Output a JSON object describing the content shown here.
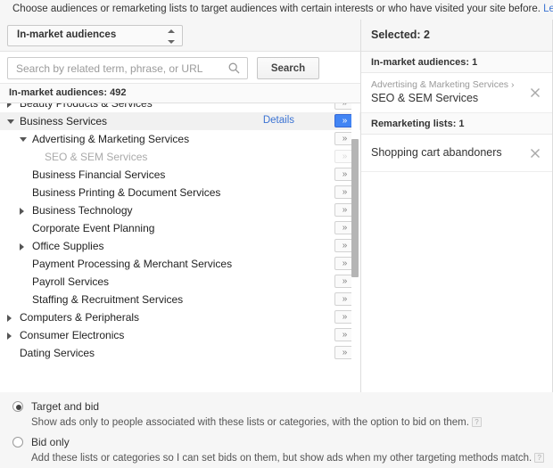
{
  "header": {
    "intro_text": "Choose audiences or remarketing lists to target audiences with certain interests or who have visited your site before.",
    "learn_more": "Learn more"
  },
  "picker": {
    "dropdown_value": "In-market audiences",
    "search": {
      "placeholder": "Search by related term, phrase, or URL",
      "value": "",
      "button_label": "Search",
      "icon": "search-icon"
    },
    "list_count_label": "In-market audiences: 492",
    "chevron_glyph": "»",
    "details_label": "Details",
    "rows": [
      {
        "label": "Beauty Products & Services",
        "indent": 0,
        "arrow": "right",
        "state": "normal",
        "chev": "normal",
        "details": false
      },
      {
        "label": "Business Services",
        "indent": 0,
        "arrow": "down",
        "state": "selected",
        "chev": "blue",
        "details": true
      },
      {
        "label": "Advertising & Marketing Services",
        "indent": 1,
        "arrow": "down",
        "state": "normal",
        "chev": "normal",
        "details": false
      },
      {
        "label": "SEO & SEM Services",
        "indent": 2,
        "arrow": "none",
        "state": "disabled",
        "chev": "off",
        "details": false
      },
      {
        "label": "Business Financial Services",
        "indent": 1,
        "arrow": "none",
        "state": "normal",
        "chev": "normal",
        "details": false
      },
      {
        "label": "Business Printing & Document Services",
        "indent": 1,
        "arrow": "none",
        "state": "normal",
        "chev": "normal",
        "details": false
      },
      {
        "label": "Business Technology",
        "indent": 1,
        "arrow": "right",
        "state": "normal",
        "chev": "normal",
        "details": false
      },
      {
        "label": "Corporate Event Planning",
        "indent": 1,
        "arrow": "none",
        "state": "normal",
        "chev": "normal",
        "details": false
      },
      {
        "label": "Office Supplies",
        "indent": 1,
        "arrow": "right",
        "state": "normal",
        "chev": "normal",
        "details": false
      },
      {
        "label": "Payment Processing & Merchant Services",
        "indent": 1,
        "arrow": "none",
        "state": "normal",
        "chev": "normal",
        "details": false
      },
      {
        "label": "Payroll Services",
        "indent": 1,
        "arrow": "none",
        "state": "normal",
        "chev": "normal",
        "details": false
      },
      {
        "label": "Staffing & Recruitment Services",
        "indent": 1,
        "arrow": "none",
        "state": "normal",
        "chev": "normal",
        "details": false
      },
      {
        "label": "Computers & Peripherals",
        "indent": 0,
        "arrow": "right",
        "state": "normal",
        "chev": "normal",
        "details": false
      },
      {
        "label": "Consumer Electronics",
        "indent": 0,
        "arrow": "right",
        "state": "normal",
        "chev": "normal",
        "details": false
      },
      {
        "label": "Dating Services",
        "indent": 0,
        "arrow": "none",
        "state": "normal",
        "chev": "normal",
        "details": false
      }
    ]
  },
  "selected": {
    "title": "Selected: 2",
    "groups": [
      {
        "title": "In-market audiences: 1",
        "items": [
          {
            "path": "Advertising & Marketing Services ›",
            "name": "SEO & SEM Services"
          }
        ]
      },
      {
        "title": "Remarketing lists: 1",
        "items": [
          {
            "path": "",
            "name": "Shopping cart abandoners"
          }
        ]
      }
    ]
  },
  "targeting": {
    "options": [
      {
        "title": "Target and bid",
        "description": "Show ads only to people associated with these lists or categories, with the option to bid on them.",
        "selected": true,
        "help": "?"
      },
      {
        "title": "Bid only",
        "description": "Add these lists or categories so I can set bids on them, but show ads when my other targeting methods match.",
        "selected": false,
        "help": "?"
      }
    ]
  },
  "colors": {
    "link": "#3b73d3",
    "accent": "#4285f4",
    "panel_bg": "#f6f6f6"
  }
}
